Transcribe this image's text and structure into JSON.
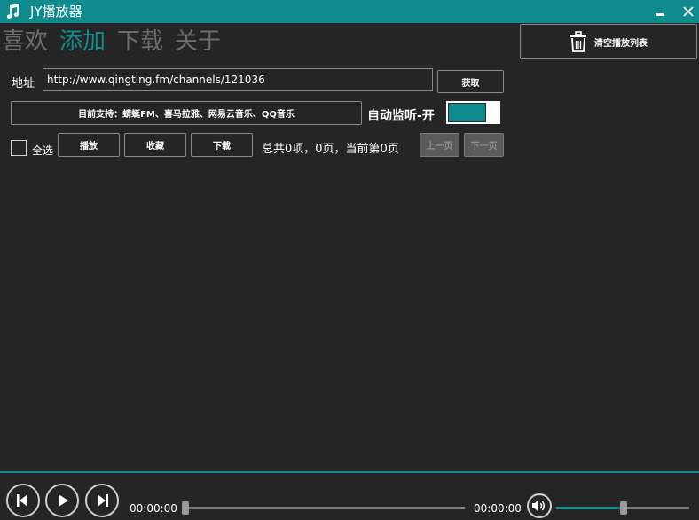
{
  "window": {
    "title": "JY播放器"
  },
  "nav": {
    "tabs": [
      {
        "label": "喜欢"
      },
      {
        "label": "添加"
      },
      {
        "label": "下载"
      },
      {
        "label": "关于"
      }
    ],
    "active": "添加"
  },
  "toolbar": {
    "clear_playlist_label": "清空播放列表"
  },
  "address": {
    "label": "地址",
    "value": "http://www.qingting.fm/channels/121036",
    "fetch_label": "获取"
  },
  "support": {
    "label": "目前支持：蜻蜓FM、喜马拉雅、网易云音乐、QQ音乐"
  },
  "auto_monitor": {
    "label": "自动监听-开",
    "on": true
  },
  "list_controls": {
    "select_all_label": "全选",
    "play_label": "播放",
    "favorite_label": "收藏",
    "download_label": "下载",
    "summary": "总共0项，0页，当前第0页",
    "prev_label": "上一页",
    "next_label": "下一页"
  },
  "player": {
    "elapsed": "00:00:00",
    "total": "00:00:00",
    "progress": 0,
    "volume": 0.5
  },
  "colors": {
    "accent": "#0f8b8d",
    "background": "#252526"
  },
  "icons": [
    "music-note-icon",
    "minimize-icon",
    "close-icon",
    "trash-icon",
    "previous-icon",
    "play-icon",
    "next-icon",
    "volume-icon"
  ]
}
